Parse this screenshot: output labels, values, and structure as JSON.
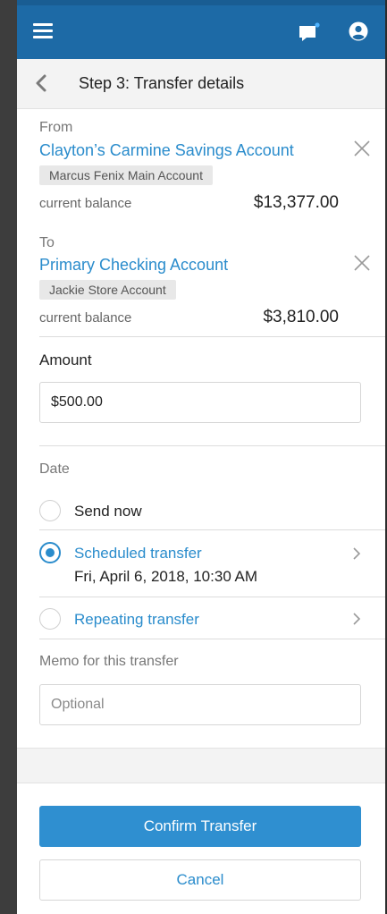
{
  "header": {
    "title": "Step 3: Transfer details"
  },
  "from": {
    "label": "From",
    "account_name": "Clayton’s Carmine Savings Account",
    "owner_tag": "Marcus Fenix Main Account",
    "balance_label": "current balance",
    "balance": "$13,377.00"
  },
  "to": {
    "label": "To",
    "account_name": "Primary Checking Account",
    "owner_tag": "Jackie Store Account",
    "balance_label": "current balance",
    "balance": "$3,810.00"
  },
  "amount": {
    "label": "Amount",
    "value": "$500.00"
  },
  "date": {
    "label": "Date",
    "options": [
      {
        "label": "Send now",
        "selected": false
      },
      {
        "label": "Scheduled transfer",
        "detail": "Fri, April 6, 2018, 10:30 AM",
        "selected": true
      },
      {
        "label": "Repeating transfer",
        "selected": false
      }
    ]
  },
  "memo": {
    "label": "Memo for this transfer",
    "placeholder": "Optional",
    "value": ""
  },
  "actions": {
    "confirm_label": "Confirm Transfer",
    "cancel_label": "Cancel"
  },
  "colors": {
    "topbar": "#1d6aa6",
    "accent": "#2a8ccc",
    "confirm_button": "#2f8fd0",
    "notification_dot": "#4fb3ff"
  },
  "icons": {
    "menu": "hamburger-icon",
    "messages": "chat-icon",
    "account": "user-icon",
    "back": "chevron-left-icon",
    "remove": "close-icon",
    "expand": "chevron-right-icon"
  }
}
